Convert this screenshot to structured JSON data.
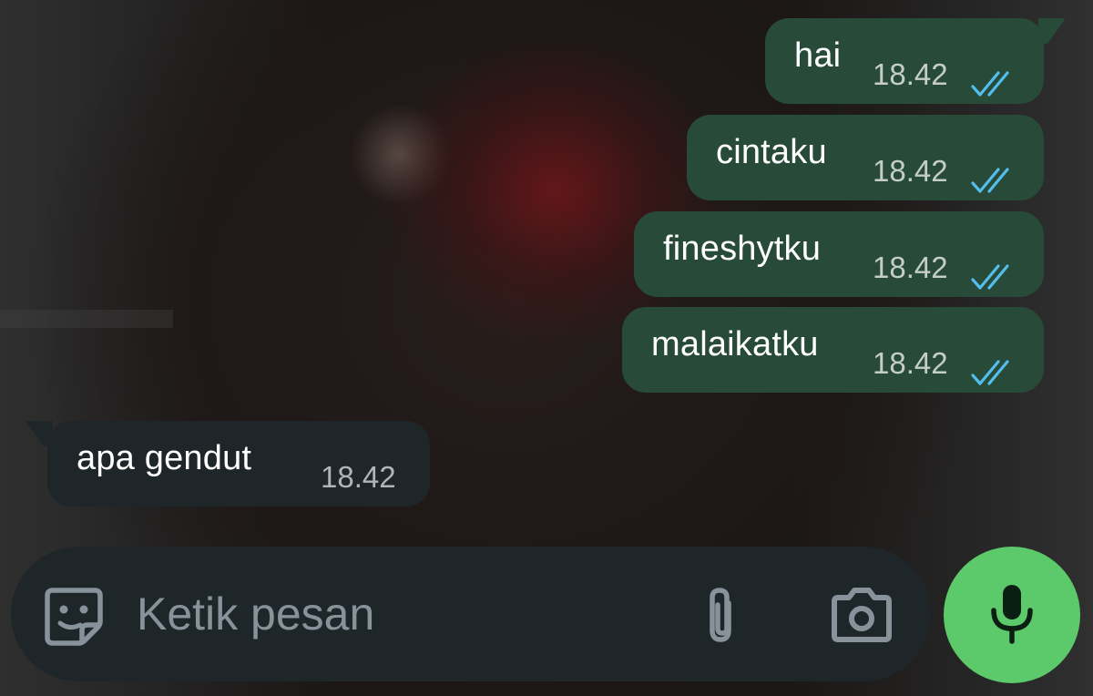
{
  "messages": [
    {
      "direction": "outgoing",
      "text": "hai",
      "time": "18.42",
      "status_icon": "double-check-read-icon"
    },
    {
      "direction": "outgoing",
      "text": "cintaku",
      "time": "18.42",
      "status_icon": "double-check-read-icon"
    },
    {
      "direction": "outgoing",
      "text": "fineshytku",
      "time": "18.42",
      "status_icon": "double-check-read-icon"
    },
    {
      "direction": "outgoing",
      "text": "malaikatku",
      "time": "18.42",
      "status_icon": "double-check-read-icon"
    },
    {
      "direction": "incoming",
      "text": "apa gendut",
      "time": "18.42"
    }
  ],
  "composer": {
    "placeholder": "Ketik pesan",
    "value": "",
    "emoji_icon": "sticker-emoji-icon",
    "attach_icon": "paperclip-icon",
    "camera_icon": "camera-icon",
    "mic_icon": "microphone-icon"
  },
  "colors": {
    "outgoing_bubble": "#274a39",
    "incoming_bubble": "#1f2629",
    "read_ticks": "#53bdeb",
    "mic_button": "#5cc96b",
    "icon_gray": "#87929a"
  }
}
